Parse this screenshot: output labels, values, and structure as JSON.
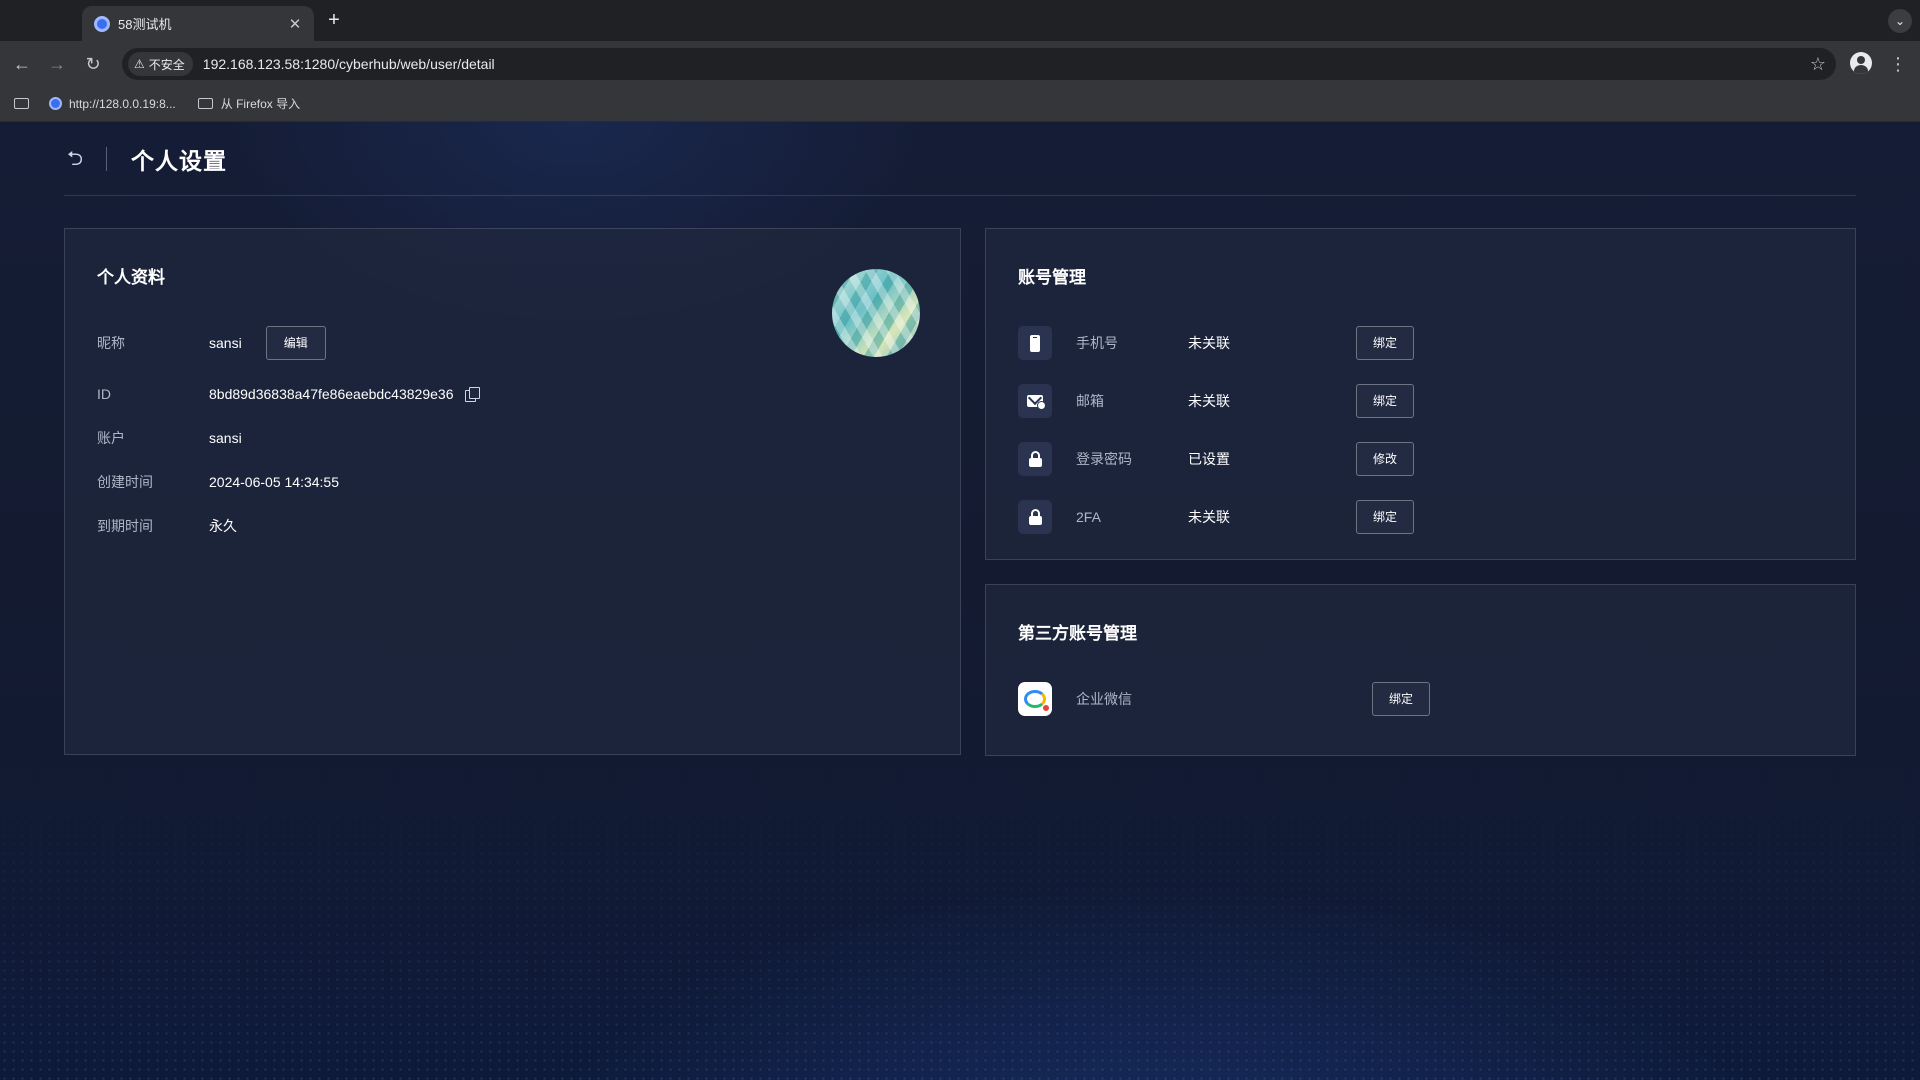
{
  "browser": {
    "tab_title": "58测试机",
    "tab_close": "✕",
    "new_tab": "+",
    "tab_menu": "⌄",
    "security_label": "不安全",
    "url": "192.168.123.58:1280/cyberhub/web/user/detail",
    "bookmarks": [
      {
        "label": "http://128.0.0.19:8...",
        "icon": "site-favicon"
      },
      {
        "label": "从 Firefox 导入",
        "icon": "folder-icon"
      }
    ]
  },
  "page": {
    "title": "个人设置"
  },
  "profile": {
    "title": "个人资料",
    "edit_label": "编辑",
    "rows": [
      {
        "label": "昵称",
        "value": "sansi"
      },
      {
        "label": "ID",
        "value": "8bd89d36838a47fe86eaebdc43829e36"
      },
      {
        "label": "账户",
        "value": "sansi"
      },
      {
        "label": "创建时间",
        "value": "2024-06-05 14:34:55"
      },
      {
        "label": "到期时间",
        "value": "永久"
      }
    ]
  },
  "account": {
    "title": "账号管理",
    "rows": [
      {
        "label": "手机号",
        "status": "未关联",
        "button": "绑定",
        "icon": "phone-icon"
      },
      {
        "label": "邮箱",
        "status": "未关联",
        "button": "绑定",
        "icon": "mail-icon"
      },
      {
        "label": "登录密码",
        "status": "已设置",
        "button": "修改",
        "icon": "lock-icon"
      },
      {
        "label": "2FA",
        "status": "未关联",
        "button": "绑定",
        "icon": "lock-icon"
      }
    ]
  },
  "third_party": {
    "title": "第三方账号管理",
    "rows": [
      {
        "label": "企业微信",
        "button": "绑定",
        "icon": "wecom-icon"
      }
    ]
  },
  "colors": {
    "background": "#141b31",
    "card": "#20283e",
    "text_primary": "#ffffff",
    "text_secondary": "#aeb6c8"
  }
}
